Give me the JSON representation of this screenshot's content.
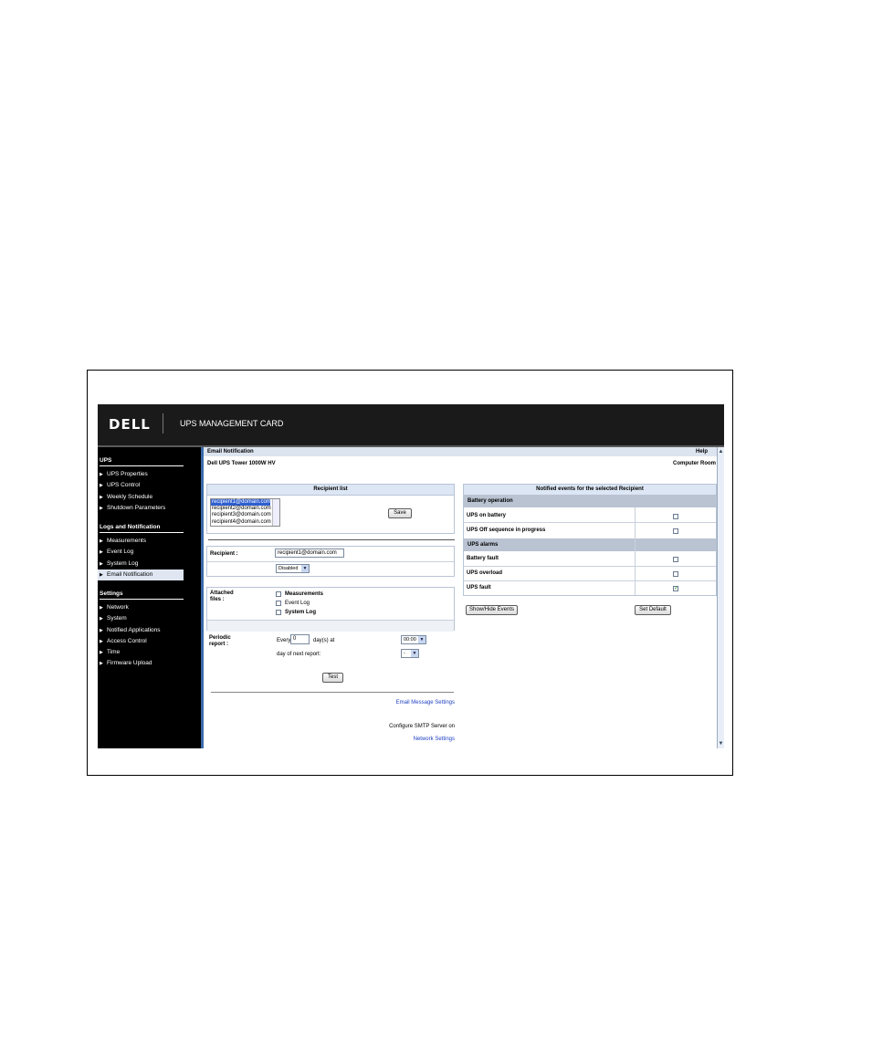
{
  "app": {
    "logo_text": "DELL",
    "title": "UPS MANAGEMENT CARD"
  },
  "sidebar": {
    "sections": [
      {
        "heading": "UPS",
        "items": [
          "UPS Properties",
          "UPS Control",
          "Weekly Schedule",
          "Shutdown Parameters"
        ]
      },
      {
        "heading": "Logs and Notification",
        "items": [
          "Measurements",
          "Event Log",
          "System Log",
          "Email Notification"
        ]
      },
      {
        "heading": "Settings",
        "items": [
          "Network",
          "System",
          "Notified Applications",
          "Access Control",
          "Time",
          "Firmware Upload"
        ]
      }
    ],
    "active_item": "Email Notification"
  },
  "page": {
    "title": "Email Notification",
    "help": "Help",
    "device": "Dell UPS Tower 1000W HV",
    "location": "Computer Room"
  },
  "recipients": {
    "heading": "Recipient list",
    "list": [
      "recipient1@domain.com",
      "recipient2@domain.com",
      "recipient3@domain.com",
      "recipient4@domain.com"
    ],
    "selected": "recipient1@domain.com",
    "save_label": "Save",
    "recipient_label": "Recipient :",
    "recipient_value": "recipient1@domain.com",
    "status_value": "Disabled",
    "attached_label": "Attached files :",
    "attached_label_1": "Attached",
    "attached_label_2": "files :",
    "attachments": [
      "Measurements",
      "Event Log",
      "System Log"
    ],
    "periodic_label_1": "Periodic",
    "periodic_label_2": "report :",
    "every_label": "Every",
    "every_value": "0",
    "days_at_label": "day(s) at",
    "time_value": "00:00",
    "next_day_label": "day of next report:",
    "next_day_value": "-",
    "test_label": "Test",
    "email_settings_link": "Email Message Settings",
    "smtp_text": "Configure SMTP Server on",
    "network_settings_link": "Network Settings"
  },
  "events": {
    "heading": "Notified events for the selected Recipient",
    "groups": [
      {
        "name": "Battery operation",
        "rows": [
          {
            "label": "UPS on battery",
            "checked": false
          },
          {
            "label": "UPS Off sequence in progress",
            "checked": false
          }
        ]
      },
      {
        "name": "UPS alarms",
        "rows": [
          {
            "label": "Battery fault",
            "checked": false
          },
          {
            "label": "UPS overload",
            "checked": false
          },
          {
            "label": "UPS fault",
            "checked": true
          }
        ]
      }
    ],
    "show_hide_label": "Show/Hide Events",
    "set_default_label": "Set Default"
  }
}
